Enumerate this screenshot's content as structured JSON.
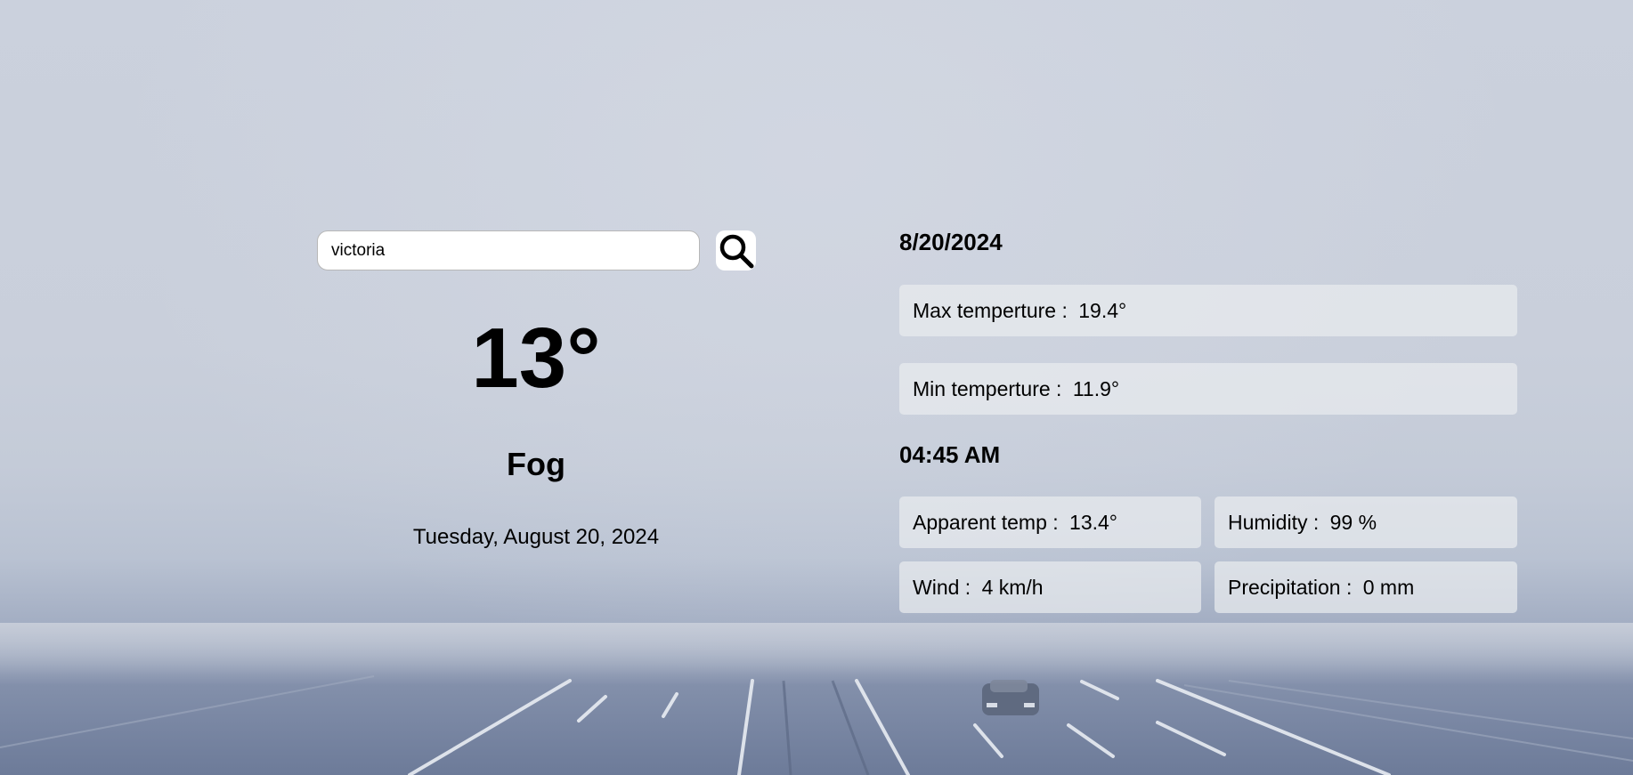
{
  "search": {
    "value": "victoria"
  },
  "current": {
    "temperature": "13°",
    "condition": "Fog",
    "date_long": "Tuesday, August 20, 2024"
  },
  "daily": {
    "date": "8/20/2024",
    "max_label": "Max temperture : ",
    "max_value": "19.4°",
    "min_label": "Min temperture : ",
    "min_value": "11.9°"
  },
  "hourly": {
    "time": "04:45 AM",
    "apparent_label": "Apparent temp : ",
    "apparent_value": "13.4°",
    "humidity_label": "Humidity : ",
    "humidity_value": "99 %",
    "wind_label": "Wind : ",
    "wind_value": "4 km/h",
    "precip_label": "Precipitation : ",
    "precip_value": "0 mm"
  },
  "icons": {
    "search": "search-icon"
  }
}
